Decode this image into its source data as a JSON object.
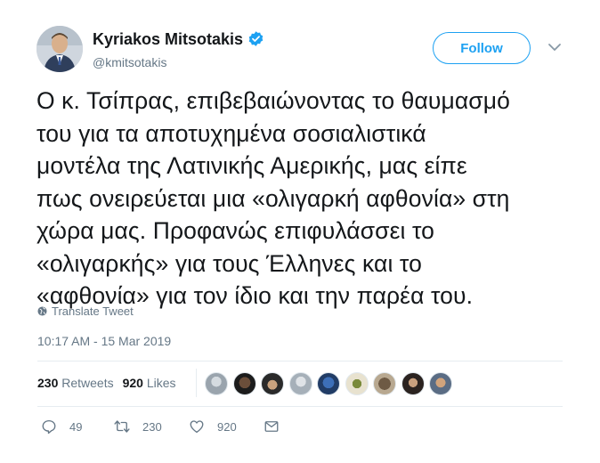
{
  "author": {
    "name": "Kyriakos Mitsotakis",
    "handle": "@kmitsotakis",
    "verified": true
  },
  "follow_label": "Follow",
  "tweet": {
    "lines": [
      "Ο κ. Τσίπρας, επιβεβαιώνοντας το θαυμασμό",
      "του για τα αποτυχημένα σοσιαλιστικά",
      "μοντέλα της Λατινικής Αμερικής, μας είπε",
      "πως ονειρεύεται μια «ολιγαρκή αφθονία» στη",
      "χώρα μας. Προφανώς επιφυλάσσει το",
      "«ολιγαρκής» για τους Έλληνες και το",
      "«αφθονία» για τον ίδιο και την παρέα του."
    ]
  },
  "translate_label": "Translate Tweet",
  "timestamp": "10:17 AM - 15 Mar 2019",
  "stats": {
    "retweets_count": "230",
    "retweets_label": "Retweets",
    "likes_count": "920",
    "likes_label": "Likes"
  },
  "actions": {
    "reply_count": "49",
    "retweet_count": "230",
    "like_count": "920"
  },
  "colors": {
    "accent": "#1da1f2",
    "secondary_text": "#657786",
    "divider": "#e6ecf0"
  },
  "icons": [
    "verified-badge-icon",
    "chevron-down-icon",
    "globe-icon",
    "reply-icon",
    "retweet-icon",
    "heart-icon",
    "mail-icon"
  ]
}
